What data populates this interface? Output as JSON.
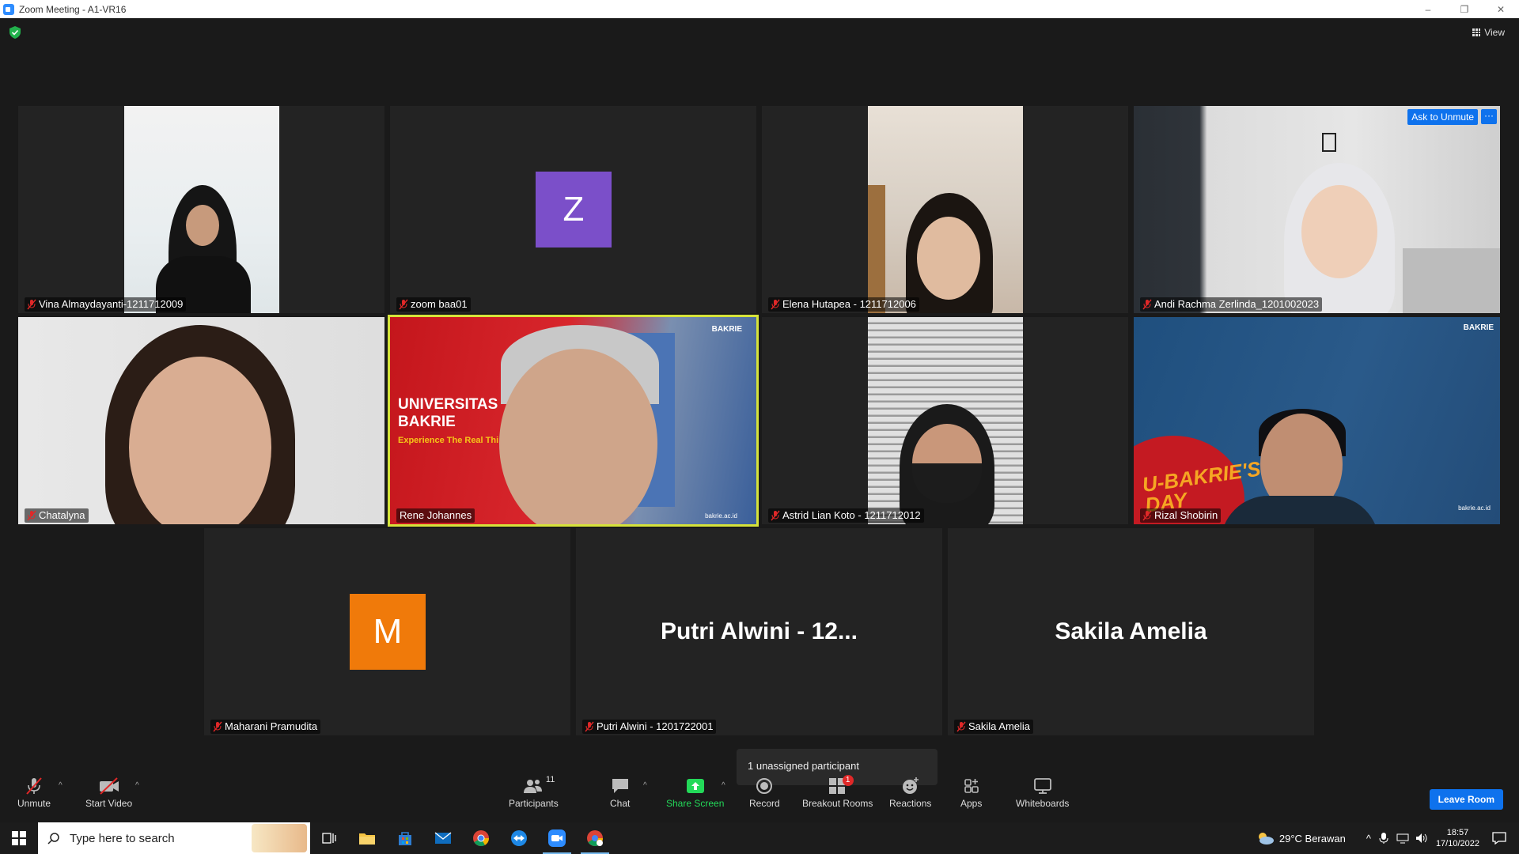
{
  "window": {
    "title": "Zoom Meeting - A1-VR16",
    "controls": [
      "–",
      "❐",
      "✕"
    ]
  },
  "header": {
    "view_label": "View"
  },
  "tiles": [
    {
      "name": "Vina Almaydayanti-1211712009",
      "muted": true
    },
    {
      "name": "zoom baa01",
      "muted": true,
      "avatar_letter": "Z",
      "avatar_color": "#7b4fc9"
    },
    {
      "name": "Elena Hutapea - 1211712006",
      "muted": true
    },
    {
      "name": "Andi Rachma Zerlinda_1201002023",
      "muted": true,
      "ask_to_unmute": "Ask to Unmute",
      "more": "···"
    },
    {
      "name": "Chatalyna",
      "muted": true
    },
    {
      "name": "Rene Johannes",
      "muted": false,
      "active_speaker": true,
      "slide_title": "UNIVERSITAS BAKRIE",
      "slide_tagline": "Experience The Real Thi",
      "slide_logo": "BAKRIE",
      "slide_url": "bakrie.ac.id"
    },
    {
      "name": "Astrid Lian Koto - 1211712012",
      "muted": true
    },
    {
      "name": "Rizal Shobirin",
      "muted": true,
      "bg_text": "U-BAKRIE'S DAY",
      "slide_logo": "BAKRIE",
      "slide_url": "bakrie.ac.id"
    },
    {
      "name": "Maharani Pramudita",
      "muted": true,
      "avatar_letter": "M",
      "avatar_color": "#f07a0a"
    },
    {
      "name": "Putri Alwini - 1201722001",
      "muted": true,
      "big_name": "Putri Alwini - 12..."
    },
    {
      "name": "Sakila Amelia",
      "muted": true,
      "big_name": "Sakila Amelia"
    }
  ],
  "tooltip": "1 unassigned participant",
  "toolbar": {
    "unmute": "Unmute",
    "start_video": "Start Video",
    "participants": "Participants",
    "participants_count": "11",
    "chat": "Chat",
    "share_screen": "Share Screen",
    "record": "Record",
    "breakout_rooms": "Breakout Rooms",
    "breakout_badge": "1",
    "reactions": "Reactions",
    "apps": "Apps",
    "whiteboards": "Whiteboards",
    "leave": "Leave Room"
  },
  "taskbar": {
    "search_placeholder": "Type here to search",
    "weather": "29°C  Berawan",
    "time": "18:57",
    "date": "17/10/2022"
  },
  "colors": {
    "accent": "#0e72ed",
    "active_border": "#d6e33a",
    "share_green": "#23d959",
    "mute_red": "#e02828"
  }
}
